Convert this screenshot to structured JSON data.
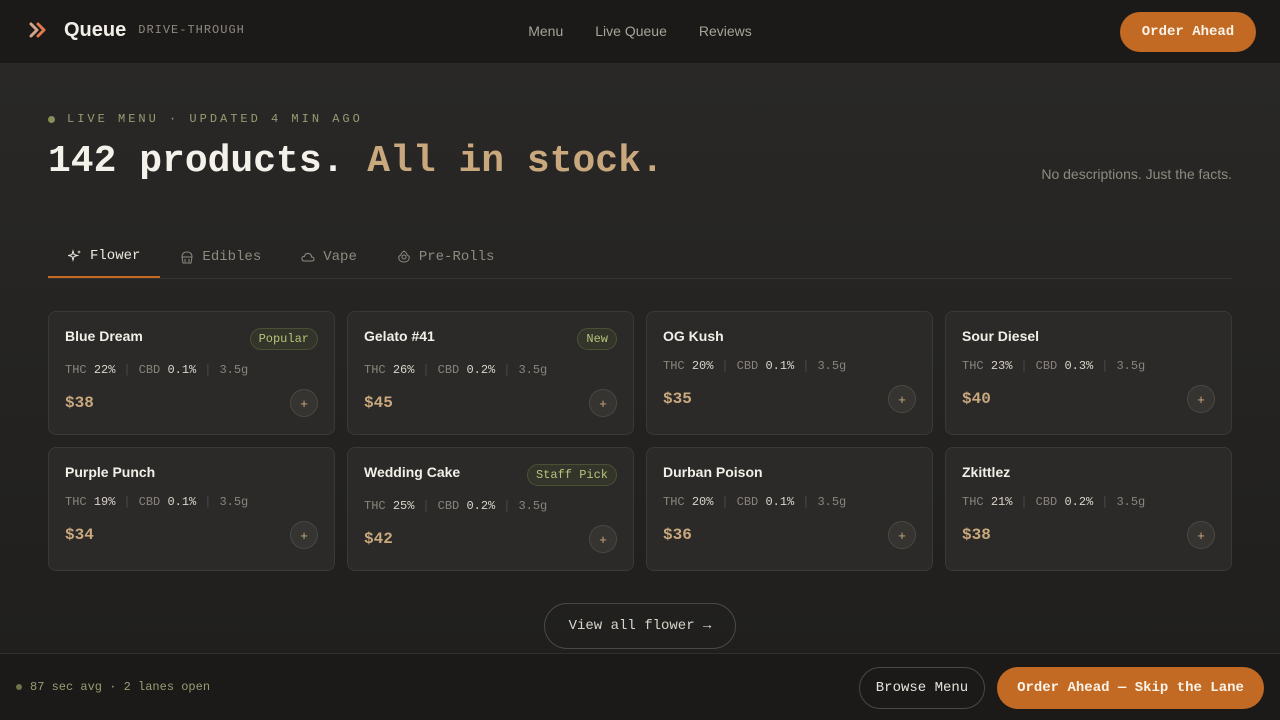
{
  "header": {
    "brand_name": "Queue",
    "brand_tag": "DRIVE-THROUGH",
    "brand_icon": "chevrons-right-icon",
    "nav": [
      "Menu",
      "Live Queue",
      "Reviews"
    ],
    "cta": "Order Ahead"
  },
  "hero": {
    "live_label": "LIVE MENU · UPDATED 4 MIN AGO",
    "headline_part1": "142 products.",
    "headline_part2": "All in stock.",
    "subnote": "No descriptions. Just the facts."
  },
  "tabs": [
    {
      "label": "Flower",
      "icon": "sparkles-icon",
      "active": true
    },
    {
      "label": "Edibles",
      "icon": "cupcake-icon",
      "active": false
    },
    {
      "label": "Vape",
      "icon": "cloud-icon",
      "active": false
    },
    {
      "label": "Pre-Rolls",
      "icon": "flower-icon",
      "active": false
    }
  ],
  "spec_labels": {
    "thc": "THC",
    "cbd": "CBD"
  },
  "products": [
    {
      "name": "Blue Dream",
      "badge": "Popular",
      "thc": "22%",
      "cbd": "0.1%",
      "weight": "3.5g",
      "price": "$38"
    },
    {
      "name": "Gelato #41",
      "badge": "New",
      "thc": "26%",
      "cbd": "0.2%",
      "weight": "3.5g",
      "price": "$45"
    },
    {
      "name": "OG Kush",
      "badge": "",
      "thc": "20%",
      "cbd": "0.1%",
      "weight": "3.5g",
      "price": "$35"
    },
    {
      "name": "Sour Diesel",
      "badge": "",
      "thc": "23%",
      "cbd": "0.3%",
      "weight": "3.5g",
      "price": "$40"
    },
    {
      "name": "Purple Punch",
      "badge": "",
      "thc": "19%",
      "cbd": "0.1%",
      "weight": "3.5g",
      "price": "$34"
    },
    {
      "name": "Wedding Cake",
      "badge": "Staff Pick",
      "thc": "25%",
      "cbd": "0.2%",
      "weight": "3.5g",
      "price": "$42"
    },
    {
      "name": "Durban Poison",
      "badge": "",
      "thc": "20%",
      "cbd": "0.1%",
      "weight": "3.5g",
      "price": "$36"
    },
    {
      "name": "Zkittlez",
      "badge": "",
      "thc": "21%",
      "cbd": "0.2%",
      "weight": "3.5g",
      "price": "$38"
    }
  ],
  "add_label": "+",
  "view_all": "View all flower →",
  "footer": {
    "status": "87 sec avg · 2 lanes open",
    "browse": "Browse Menu",
    "cta": "Order Ahead — Skip the Lane"
  },
  "colors": {
    "accent": "#c26a24",
    "price": "#c9a87e",
    "badge_text": "#b9c27a",
    "background": "#232220"
  }
}
